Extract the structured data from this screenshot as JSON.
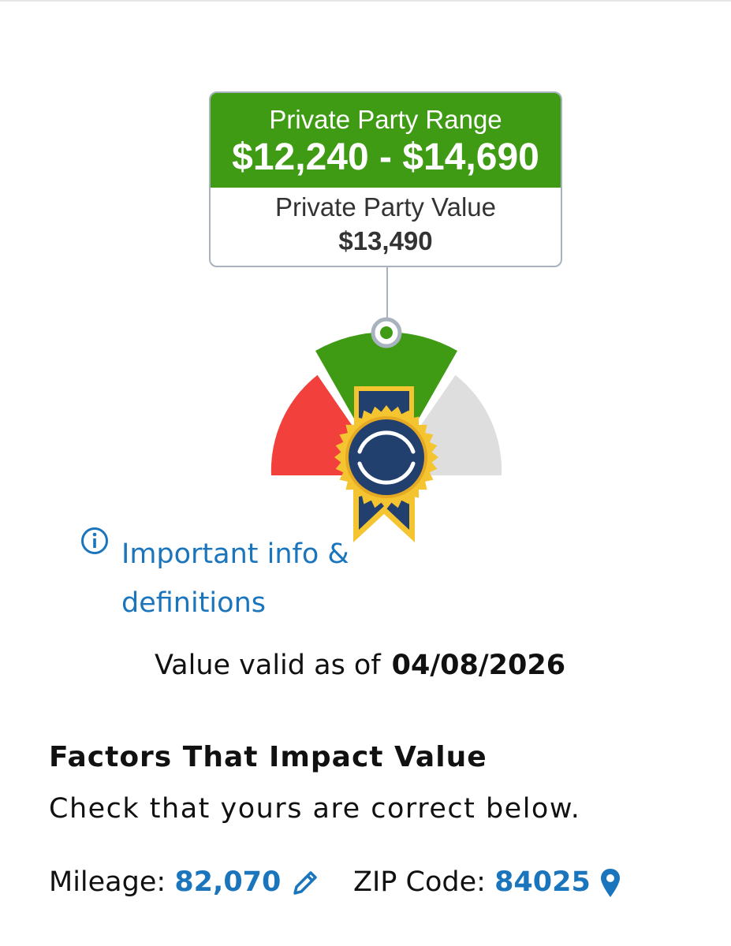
{
  "price_box": {
    "range_label": "Private Party Range",
    "range_value": "$12,240 - $14,690",
    "value_label": "Private Party Value",
    "value_amount": "$13,490"
  },
  "gauge": {
    "segments": [
      "red",
      "green",
      "gray"
    ],
    "colors": {
      "low": "#f2403c",
      "fair": "#3f9a14",
      "high": "#dedede",
      "badge_blue": "#22406e",
      "badge_gold": "#f4c431"
    },
    "logo_icon": "kbb-ribbon-badge-icon"
  },
  "info_link": {
    "icon": "info-circle-icon",
    "text": "Important info & definitions"
  },
  "valid": {
    "prefix": "Value valid as of",
    "date": "04/08/2026"
  },
  "factors": {
    "title": "Factors That Impact Value",
    "subtitle": "Check that yours are correct below.",
    "mileage_label": "Mileage:",
    "mileage_value": "82,070",
    "mileage_icon": "pencil-icon",
    "zip_label": "ZIP Code:",
    "zip_value": "84025",
    "zip_icon": "map-pin-icon"
  },
  "colors": {
    "accent": "#1b75bc",
    "range_green": "#3f9a14",
    "border": "#a9b3c0"
  }
}
